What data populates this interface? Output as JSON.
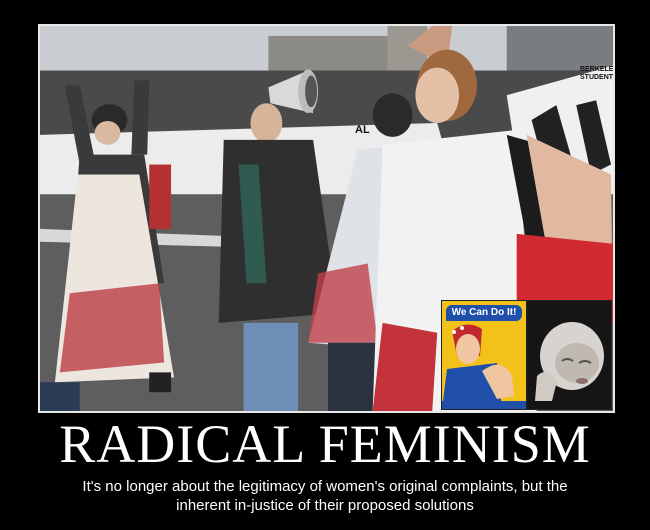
{
  "poster": {
    "title": "RADICAL FEMINISM",
    "caption_line1": "It's no longer about the legitimacy of women's original complaints, but the",
    "caption_line2": "inherent in-justice of their proposed solutions"
  },
  "photo": {
    "banner_text": "BERKELEY STUDENTS",
    "sign_text": "AL"
  },
  "inset_rosie": {
    "banner": "We Can Do It!"
  },
  "colors": {
    "background": "#000000",
    "frame": "#e8e8e8",
    "text": "#ffffff",
    "blood": "#b8323a",
    "rosie_yellow": "#f2c21b",
    "rosie_blue": "#1f4fa8"
  }
}
